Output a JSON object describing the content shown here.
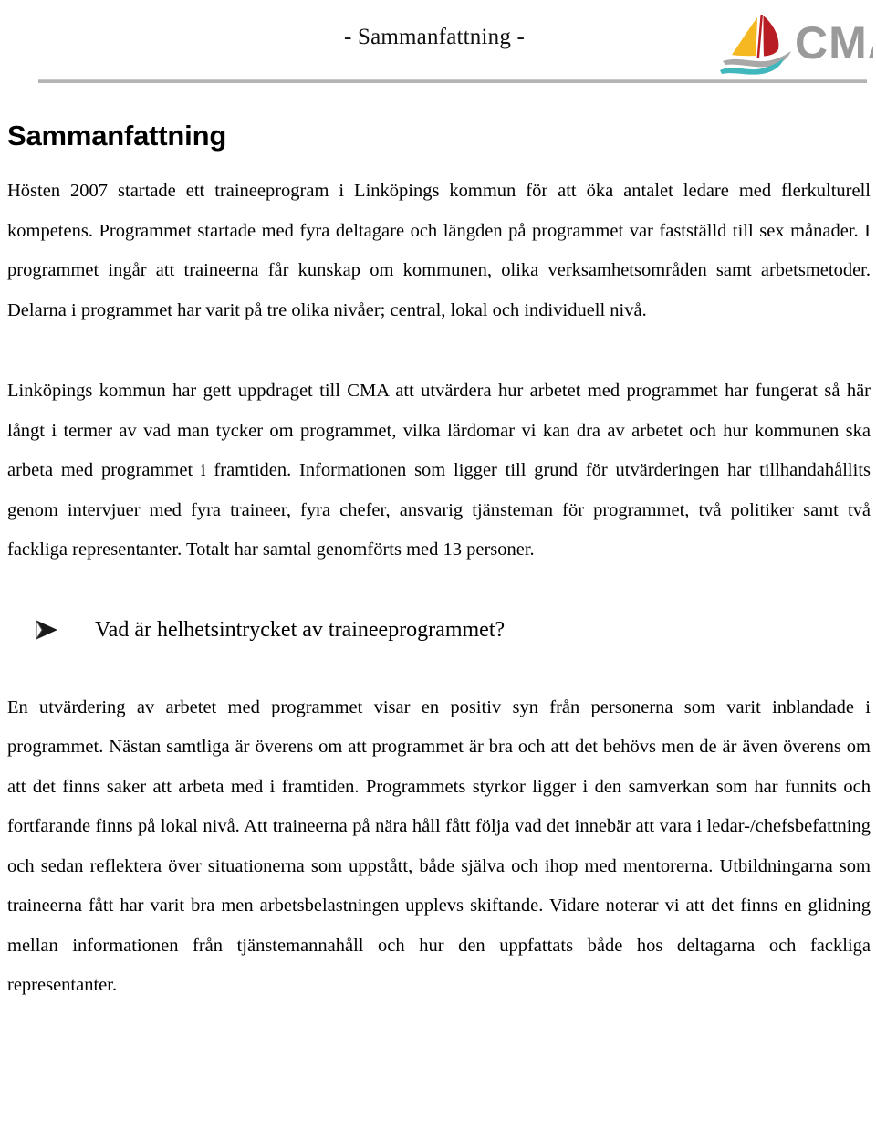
{
  "header": {
    "title": "- Sammanfattning -",
    "logo": {
      "name": "cma-logo",
      "wordmark": "CMA",
      "icon_name": "sailboat-icon",
      "colors": {
        "front_sail": "#f5b820",
        "main_sail": "#b81d24",
        "hull_wave": "#a8a8a8",
        "water_wave": "#3fb7bc",
        "wordmark": "#9a9a9a"
      }
    },
    "rule_color": "#b3b3b3"
  },
  "document": {
    "heading": "Sammanfattning",
    "paragraphs": [
      "Hösten 2007 startade ett traineeprogram i Linköpings kommun för att öka antalet ledare med flerkulturell kompetens. Programmet startade med fyra deltagare och längden på programmet var fastställd till sex månader. I programmet ingår att traineerna får kunskap om kommunen, olika verksamhetsområden samt arbetsmetoder. Delarna i programmet har varit på tre olika nivåer; central, lokal och individuell nivå.",
      "Linköpings kommun har gett uppdraget till CMA att utvärdera hur arbetet med programmet har fungerat så här långt i termer av vad man tycker om programmet, vilka lärdomar vi kan dra av arbetet och hur kommunen ska arbeta med programmet i framtiden. Informationen som ligger till grund för utvärderingen har tillhandahållits genom intervjuer med fyra traineer, fyra chefer, ansvarig tjänsteman för programmet, två politiker samt två fackliga representanter. Totalt har samtal genomförts med 13 personer."
    ],
    "question_heading": {
      "bullet": "➢",
      "text": "Vad är helhetsintrycket av traineeprogrammet?"
    },
    "answer_paragraph": "En utvärdering av arbetet med programmet visar en positiv syn från personerna som varit inblandade i programmet. Nästan samtliga är överens om att programmet är bra och att det behövs men de är även överens om att det finns saker att arbeta med i framtiden. Programmets styrkor ligger i den samverkan som har funnits och fortfarande finns på lokal nivå. Att traineerna på nära håll fått följa vad det innebär att vara i ledar-/chefsbefattning och sedan reflektera över situationerna som uppstått, både själva och ihop med mentorerna. Utbildningarna som traineerna fått har varit bra men arbetsbelastningen upplevs skiftande. Vidare noterar vi att det finns en glidning mellan informationen från tjänstemannahåll och hur den uppfattats både hos deltagarna och fackliga representanter."
  }
}
